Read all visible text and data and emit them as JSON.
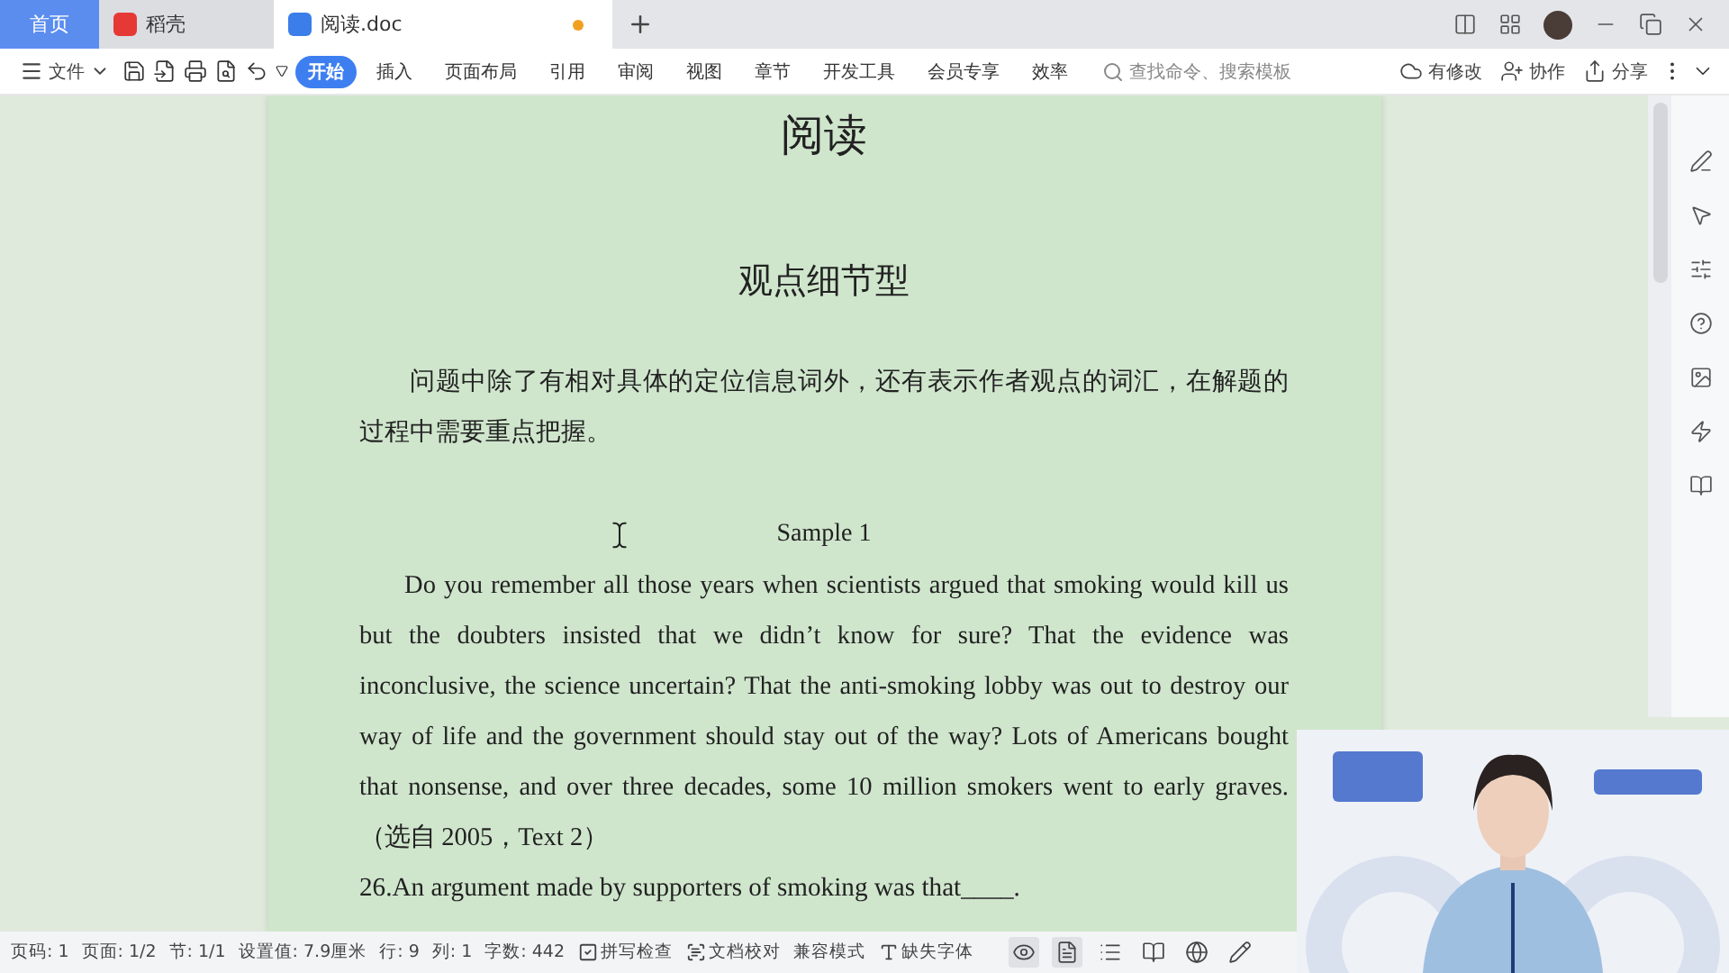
{
  "tabs": [
    {
      "label": "首页",
      "kind": "home",
      "selected": false
    },
    {
      "label": "稻壳",
      "kind": "docer",
      "selected": false
    },
    {
      "label": "阅读.doc",
      "kind": "doc",
      "selected": true,
      "unsaved": true
    }
  ],
  "menu": {
    "label": "文件"
  },
  "ribbon": [
    {
      "label": "开始",
      "selected": true
    },
    {
      "label": "插入",
      "selected": false
    },
    {
      "label": "页面布局",
      "selected": false
    },
    {
      "label": "引用",
      "selected": false
    },
    {
      "label": "审阅",
      "selected": false
    },
    {
      "label": "视图",
      "selected": false
    },
    {
      "label": "章节",
      "selected": false
    },
    {
      "label": "开发工具",
      "selected": false
    },
    {
      "label": "会员专享",
      "selected": false
    },
    {
      "label": "效率",
      "selected": false
    }
  ],
  "search": {
    "placeholder": "查找命令、搜索模板"
  },
  "actions": [
    {
      "label": "有修改",
      "kind": "cloud"
    },
    {
      "label": "协作",
      "kind": "user"
    },
    {
      "label": "分享",
      "kind": "share"
    }
  ],
  "document": {
    "title": "阅读",
    "subtitle": "观点细节型",
    "intro": "问题中除了有相对具体的定位信息词外，还有表示作者观点的词汇，在解题的过程中需要重点把握。",
    "sample": "Sample 1",
    "passage": "Do you remember all those years when scientists argued that smoking would kill us but the doubters insisted that we didn’t know for sure? That the evidence was inconclusive, the science uncertain? That the anti-smoking lobby was out to destroy our way of life and the government should stay out of the way? Lots of Americans bought that nonsense, and over three decades, some 10 million smokers went to early graves.（选自 2005，Text 2）",
    "question": "26.An argument made by supporters of smoking was that____."
  },
  "status": [
    {
      "label": "页码: 1",
      "kind": "text"
    },
    {
      "label": "页面: 1/2",
      "kind": "text"
    },
    {
      "label": "节: 1/1",
      "kind": "text"
    },
    {
      "label": "设置值: 7.9厘米",
      "kind": "text"
    },
    {
      "label": "行: 9",
      "kind": "text"
    },
    {
      "label": "列: 1",
      "kind": "text"
    },
    {
      "label": "字数: 442",
      "kind": "text"
    },
    {
      "label": "拼写检查",
      "kind": "spell"
    },
    {
      "label": "文档校对",
      "kind": "proof"
    },
    {
      "label": "兼容模式",
      "kind": "text"
    },
    {
      "label": "缺失字体",
      "kind": "font"
    }
  ],
  "views": [
    {
      "kind": "eye",
      "selected": true
    },
    {
      "kind": "page",
      "selected": true
    },
    {
      "kind": "outline",
      "selected": false
    },
    {
      "kind": "read",
      "selected": false
    },
    {
      "kind": "web",
      "selected": false
    },
    {
      "kind": "pen",
      "selected": false
    }
  ]
}
